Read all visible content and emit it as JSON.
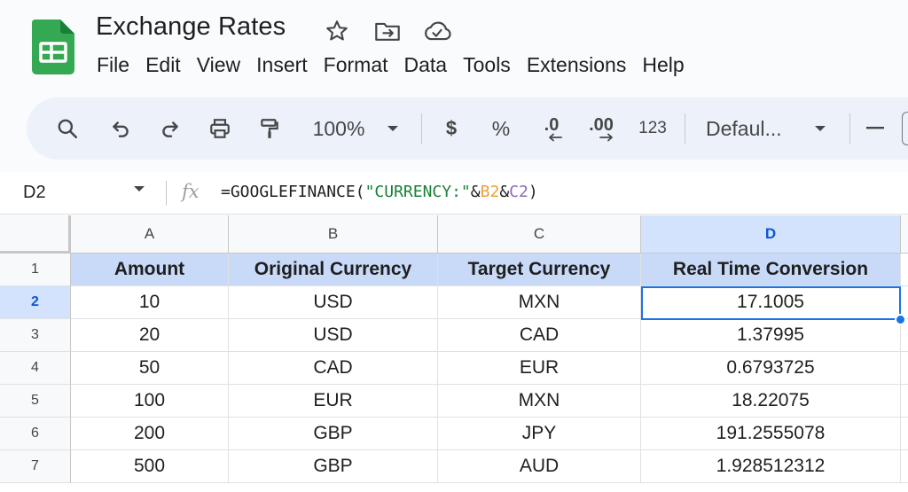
{
  "document": {
    "title": "Exchange Rates"
  },
  "title_icons": [
    "star-icon",
    "move-to-folder-icon",
    "cloud-saved-icon"
  ],
  "menu": [
    "File",
    "Edit",
    "View",
    "Insert",
    "Format",
    "Data",
    "Tools",
    "Extensions",
    "Help"
  ],
  "toolbar": {
    "zoom": "100%",
    "currency": "$",
    "percent": "%",
    "decrease_decimal": ".0",
    "increase_decimal": ".00",
    "number_format": "123",
    "font": "Defaul..."
  },
  "formula_bar": {
    "name_box": "D2",
    "fx": "fx",
    "formula_parts": [
      "=GOOGLEFINANCE(",
      "\"CURRENCY:\"",
      "&",
      "B2",
      "&",
      "C2",
      ")"
    ]
  },
  "grid": {
    "columns": [
      "A",
      "B",
      "C",
      "D"
    ],
    "selected_column": "D",
    "selected_row": "2",
    "rows": [
      {
        "num": "1",
        "cells": [
          "Amount",
          "Original Currency",
          "Target Currency",
          "Real Time Conversion"
        ]
      },
      {
        "num": "2",
        "cells": [
          "10",
          "USD",
          "MXN",
          "17.1005"
        ]
      },
      {
        "num": "3",
        "cells": [
          "20",
          "USD",
          "CAD",
          "1.37995"
        ]
      },
      {
        "num": "4",
        "cells": [
          "50",
          "CAD",
          "EUR",
          "0.6793725"
        ]
      },
      {
        "num": "5",
        "cells": [
          "100",
          "EUR",
          "MXN",
          "18.22075"
        ]
      },
      {
        "num": "6",
        "cells": [
          "200",
          "GBP",
          "JPY",
          "191.2555078"
        ]
      },
      {
        "num": "7",
        "cells": [
          "500",
          "GBP",
          "AUD",
          "1.928512312"
        ]
      }
    ]
  },
  "colors": {
    "header_fill": "#c9daf8",
    "selection": "#1a73e8",
    "logo_green": "#34a853"
  }
}
